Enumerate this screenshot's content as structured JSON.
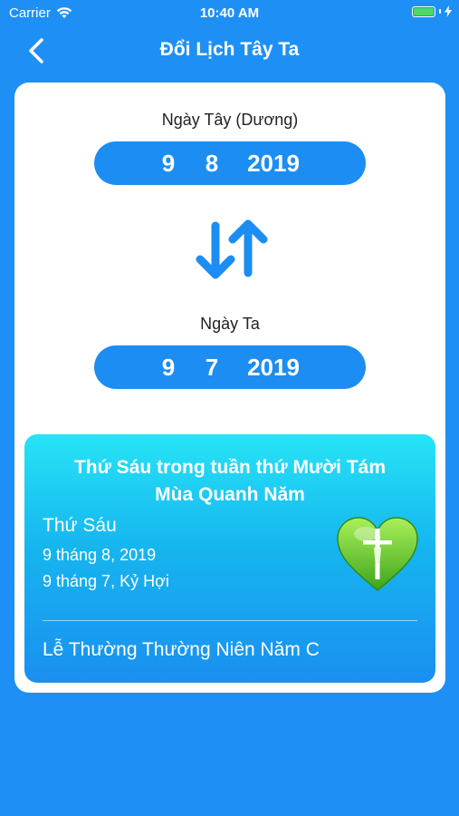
{
  "status_bar": {
    "carrier": "Carrier",
    "time": "10:40 AM"
  },
  "nav": {
    "title": "Đổi Lịch Tây Ta",
    "back_icon": "chevron-left-icon"
  },
  "solar": {
    "label": "Ngày Tây (Dương)",
    "day": "9",
    "month": "8",
    "year": "2019"
  },
  "swap": {
    "icon": "swap-arrows-icon"
  },
  "lunar": {
    "label": "Ngày Ta",
    "day": "9",
    "month": "7",
    "year": "2019"
  },
  "info": {
    "feast_line1": "Thứ Sáu trong tuần thứ Mười Tám",
    "feast_line2": "Mùa Quanh Năm",
    "weekday": "Thứ Sáu",
    "solar_text": "9 tháng 8, 2019",
    "lunar_text": "9 tháng 7, Kỷ Hợi",
    "season": "Lễ Thường Thường Niên Năm C",
    "icon": "heart-cross-icon"
  },
  "colors": {
    "background": "#1e90f5",
    "pill": "#1c8df3",
    "heart": "#6ddb2c"
  }
}
